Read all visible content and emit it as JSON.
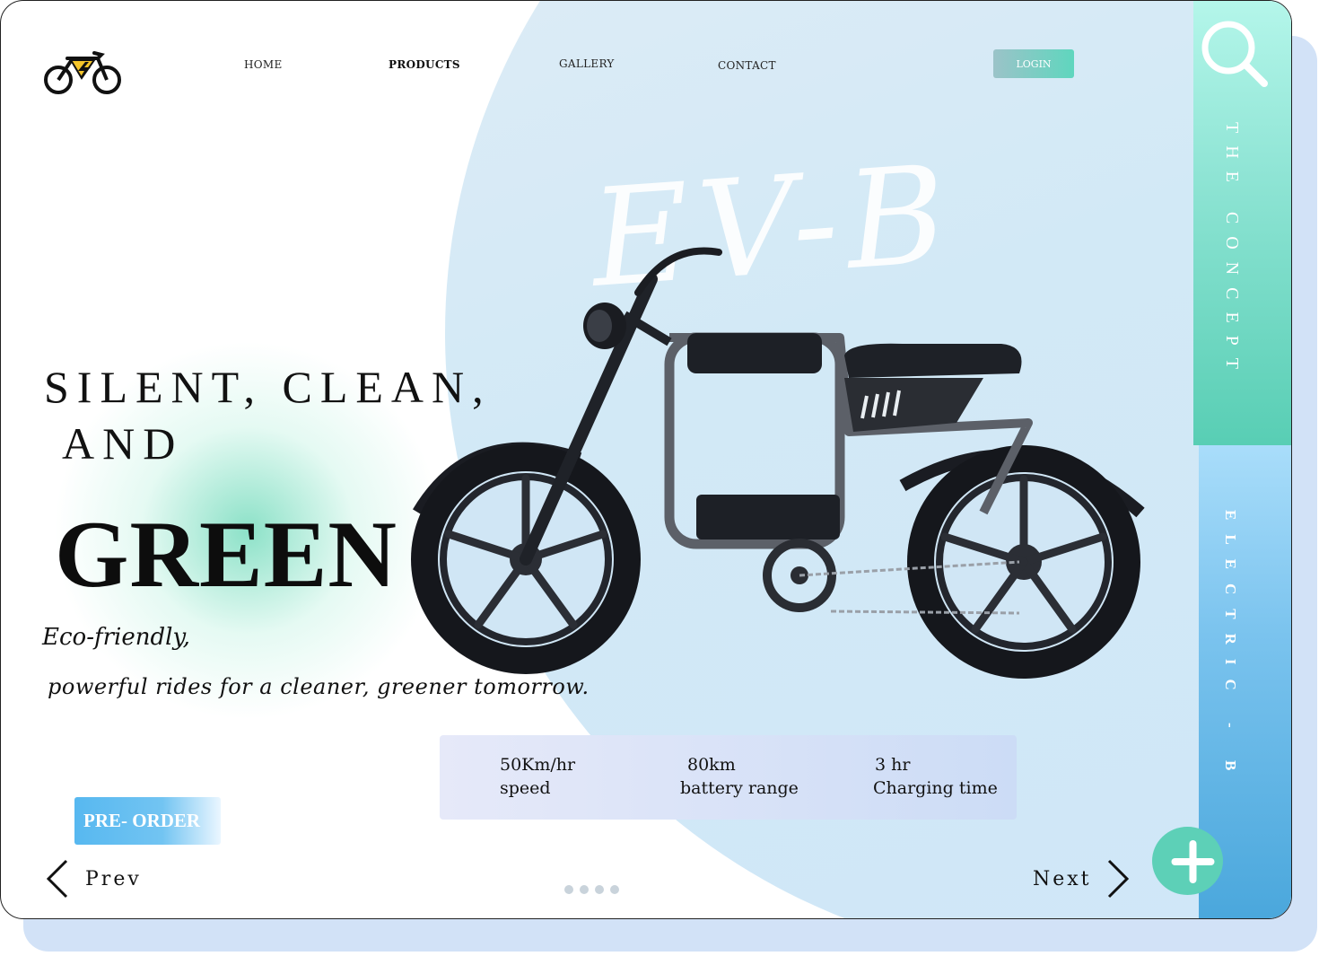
{
  "nav": {
    "items": [
      {
        "label": "HOME"
      },
      {
        "label": "PRODUCTS"
      },
      {
        "label": "GALLERY"
      },
      {
        "label": "CONTACT"
      }
    ],
    "login_label": "LOGIN"
  },
  "hero": {
    "watermark": "EV-B",
    "line1": "SILENT, CLEAN,",
    "line2": "AND",
    "big_word": "GREEN",
    "tagline1": "Eco-friendly,",
    "tagline2": "powerful rides for a cleaner, greener tomorrow."
  },
  "specs": [
    {
      "value": "50Km/hr",
      "label": "speed"
    },
    {
      "value": "80km",
      "label": "battery range"
    },
    {
      "value": "3 hr",
      "label": "Charging time"
    }
  ],
  "actions": {
    "preorder_label": "PRE- ORDER",
    "prev_label": "Prev",
    "next_label": "Next"
  },
  "pager": {
    "count": 4
  },
  "side": {
    "top_text": "THE CONCEPT",
    "bottom_text": "ELECTRIC - B"
  },
  "icons": {
    "logo": "bicycle-logo-icon",
    "search": "search-icon",
    "prev": "chevron-left-icon",
    "next": "chevron-right-icon",
    "add": "plus-icon"
  },
  "colors": {
    "accent_green": "#5dd0b7",
    "accent_blue": "#57b8f0",
    "specs_bg": "#dde4f8"
  }
}
